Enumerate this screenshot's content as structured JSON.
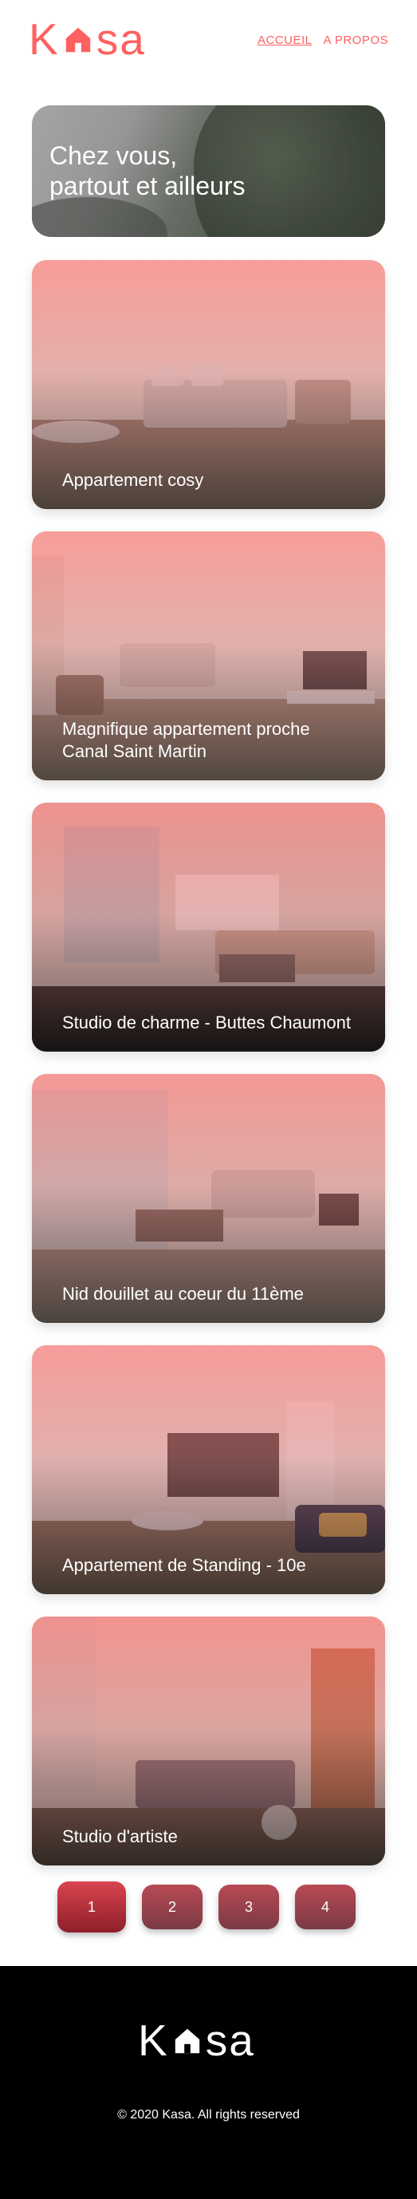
{
  "header": {
    "logo_left": "K",
    "logo_right": "sa",
    "nav": [
      {
        "label": "ACCUEIL",
        "active": true
      },
      {
        "label": "A PROPOS",
        "active": false
      }
    ]
  },
  "banner": {
    "title_line1": "Chez vous,",
    "title_line2": "partout et ailleurs"
  },
  "listings": [
    {
      "title": "Appartement cosy"
    },
    {
      "title": "Magnifique appartement proche Canal Saint Martin"
    },
    {
      "title": "Studio de charme - Buttes Chaumont"
    },
    {
      "title": "Nid douillet au coeur du 11ème"
    },
    {
      "title": "Appartement de Standing - 10e"
    },
    {
      "title": "Studio d'artiste"
    }
  ],
  "pagination": {
    "pages": [
      "1",
      "2",
      "3",
      "4"
    ],
    "current": "1"
  },
  "footer": {
    "logo_left": "K",
    "logo_right": "sa",
    "copyright": "© 2020 Kasa. All rights reserved"
  },
  "colors": {
    "brand": "#ff6060",
    "footer_bg": "#000000"
  },
  "icons": {
    "logo_mark": "house-icon"
  }
}
